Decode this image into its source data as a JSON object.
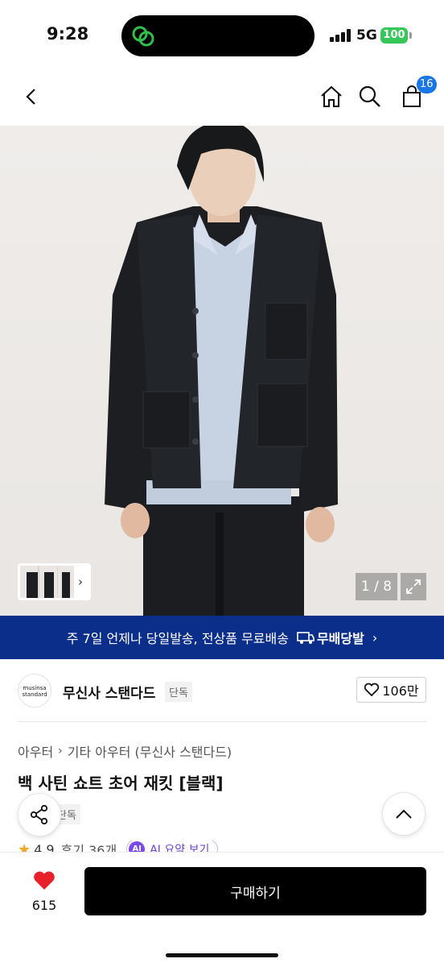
{
  "status_bar": {
    "time": "9:28",
    "network": "5G",
    "battery": "100"
  },
  "nav": {
    "cart_count": "16",
    "icons": [
      "back-icon",
      "home-icon",
      "search-icon",
      "shopping-bag-icon"
    ]
  },
  "gallery": {
    "counter": "1 / 8",
    "icons": [
      "chevron-right-icon",
      "expand-icon"
    ]
  },
  "banner": {
    "text": "주 7일 언제나 당일발송, 전상품 무료배송",
    "logo_text": "무배당발",
    "color": "#0b2e8a"
  },
  "brand": {
    "logo_line1": "musinsa",
    "logo_line2": "standard",
    "name": "무신사 스탠다드",
    "tag": "단독",
    "likes": "106만"
  },
  "breadcrumb": [
    "아우터",
    "기타 아우터 (무신사 스탠다드)"
  ],
  "product": {
    "title": "백 사틴 쇼트 초어 재킷 [블랙]",
    "tag": "단독"
  },
  "rating": {
    "score": "4.9",
    "reviews": "후기 36개",
    "ai_badge": "AI",
    "ai_label": "AI 요약 보기"
  },
  "bottom_bar": {
    "wish_count": "615",
    "buy_label": "구매하기"
  },
  "colors": {
    "accent_blue": "#1976e8",
    "heart_red": "#e8202a",
    "battery_green": "#35c759"
  }
}
